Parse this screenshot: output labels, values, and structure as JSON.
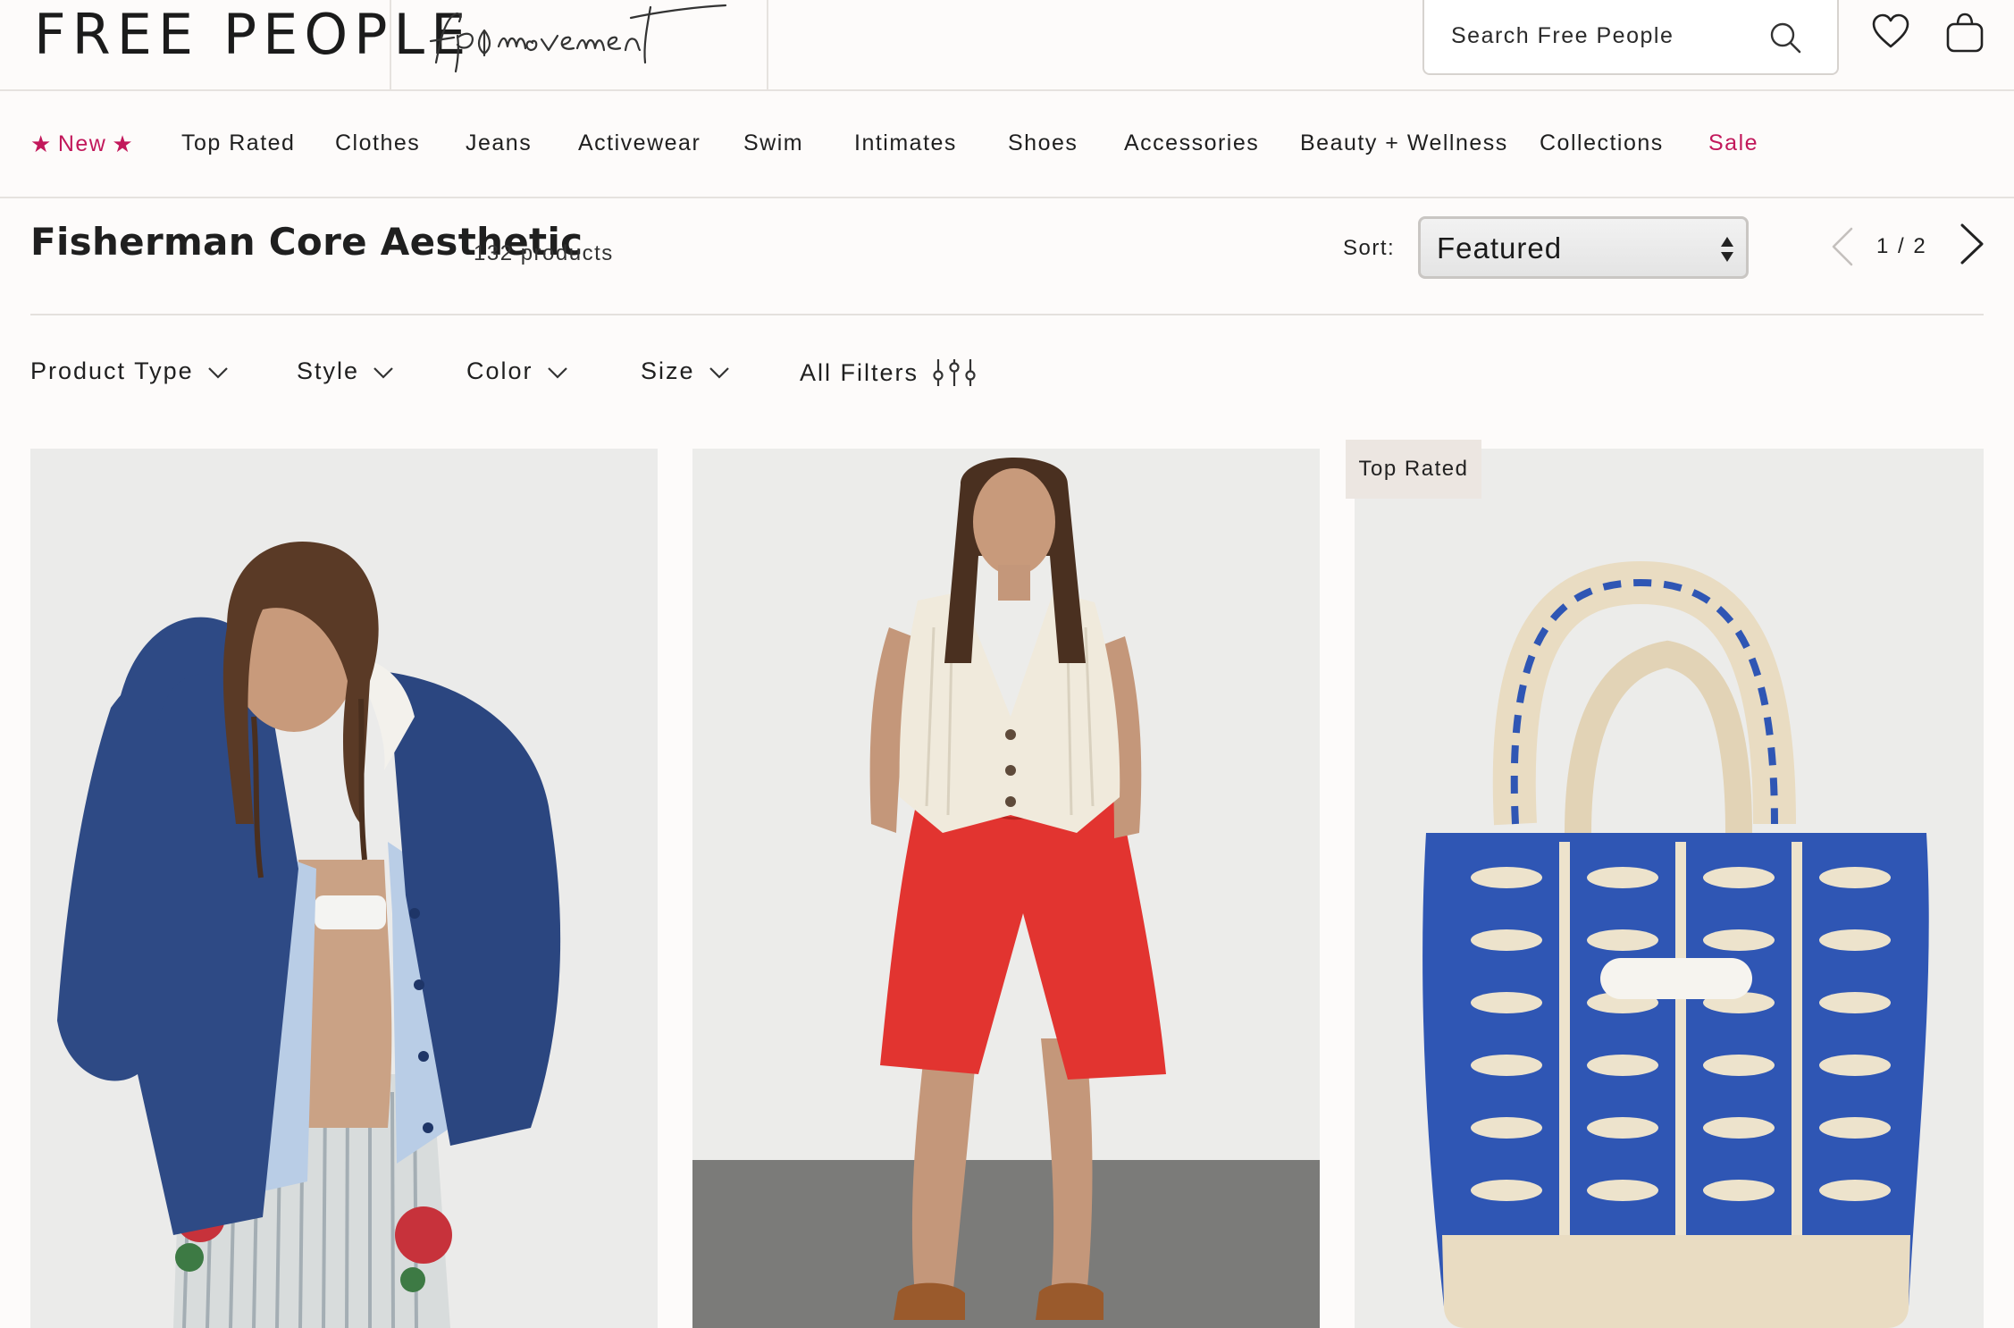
{
  "header": {
    "brand": "FREE PEOPLE",
    "movement_logo_text": "fp movement",
    "search": {
      "placeholder": "Search Free People",
      "value": ""
    },
    "icons": [
      "search-icon",
      "heart-icon",
      "bag-icon"
    ]
  },
  "nav": {
    "items": [
      {
        "label": "New",
        "highlight": true
      },
      {
        "label": "Top Rated"
      },
      {
        "label": "Clothes"
      },
      {
        "label": "Jeans"
      },
      {
        "label": "Activewear"
      },
      {
        "label": "Swim"
      },
      {
        "label": "Intimates"
      },
      {
        "label": "Shoes"
      },
      {
        "label": "Accessories"
      },
      {
        "label": "Beauty + Wellness"
      },
      {
        "label": "Collections"
      },
      {
        "label": "Sale",
        "highlight": true
      }
    ]
  },
  "collection": {
    "title": "Fisherman Core Aesthetic",
    "count": "132 products"
  },
  "sort": {
    "label": "Sort:",
    "selected": "Featured"
  },
  "pagination": {
    "indicator": "1 / 2",
    "current": 1,
    "total": 2
  },
  "filters": [
    {
      "label": "Product Type",
      "icon": "chevron-down-icon"
    },
    {
      "label": "Style",
      "icon": "chevron-down-icon"
    },
    {
      "label": "Color",
      "icon": "chevron-down-icon"
    },
    {
      "label": "Size",
      "icon": "chevron-down-icon"
    },
    {
      "label": "All Filters",
      "icon": "sliders-icon"
    }
  ],
  "products": [
    {
      "image": "model in navy corduroy jacket, light blue shirt and striped embroidered jeans",
      "badge": ""
    },
    {
      "image": "model in cream knit vest and red drawstring bermuda shorts",
      "badge": ""
    },
    {
      "image": "blue and cream fish-print canvas tote bag",
      "badge": "Top Rated"
    }
  ],
  "colors": {
    "accent_pink": "#c2185b",
    "background": "#fdfbfa",
    "text": "#1f1f1f",
    "divider": "#e6e2df",
    "badge_bg": "#ece6e1"
  }
}
